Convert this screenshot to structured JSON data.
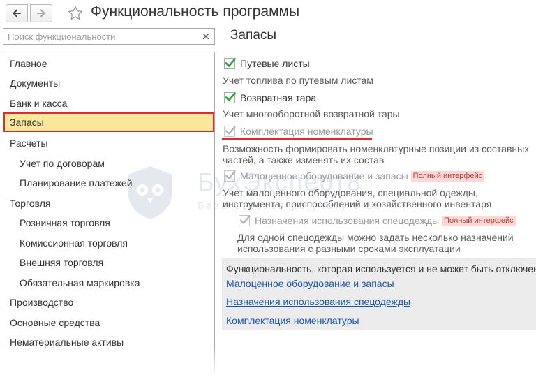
{
  "header": {
    "title": "Функциональность программы",
    "back_icon": "arrow-left-icon",
    "forward_icon": "arrow-right-icon",
    "favorite_icon": "star-icon"
  },
  "search": {
    "placeholder": "Поиск функциональности",
    "value": "",
    "clear_icon": "close-icon"
  },
  "sidebar": {
    "items": [
      {
        "label": "Главное",
        "level": 0,
        "selected": false
      },
      {
        "label": "Документы",
        "level": 0,
        "selected": false
      },
      {
        "label": "Банк и касса",
        "level": 0,
        "selected": false
      },
      {
        "label": "Запасы",
        "level": 0,
        "selected": true
      },
      {
        "label": "Расчеты",
        "level": 0,
        "selected": false
      },
      {
        "label": "Учет по договорам",
        "level": 1,
        "selected": false
      },
      {
        "label": "Планирование платежей",
        "level": 1,
        "selected": false
      },
      {
        "label": "Торговля",
        "level": 0,
        "selected": false
      },
      {
        "label": "Розничная торговля",
        "level": 1,
        "selected": false
      },
      {
        "label": "Комиссионная торговля",
        "level": 1,
        "selected": false
      },
      {
        "label": "Внешняя торговля",
        "level": 1,
        "selected": false
      },
      {
        "label": "Обязательная маркировка",
        "level": 1,
        "selected": false
      },
      {
        "label": "Производство",
        "level": 0,
        "selected": false
      },
      {
        "label": "Основные средства",
        "level": 0,
        "selected": false
      },
      {
        "label": "Нематериальные активы",
        "level": 0,
        "selected": false
      }
    ]
  },
  "main": {
    "section_title": "Запасы",
    "options": [
      {
        "label": "Путевые листы",
        "checked": true,
        "enabled": true,
        "description": "Учет топлива по путевым листам"
      },
      {
        "label": "Возвратная тара",
        "checked": true,
        "enabled": true,
        "description": "Учет многооборотной возвратной тары"
      },
      {
        "label": "Комплектация номенклатуры",
        "checked": true,
        "enabled": false,
        "description_line1": "Возможность формировать номенклатурные позиции из составных",
        "description_line2": "частей, а также изменять их состав"
      },
      {
        "label": "Малоценное оборудование и запасы",
        "checked": true,
        "enabled": false,
        "badge": "Полный интерфейс",
        "description_line1": "Учет малоценного оборудования, специальной одежды,",
        "description_line2": "инструмента, приспособлений и хозяйственного инвентаря"
      },
      {
        "label": "Назначения использования спецодежды",
        "checked": true,
        "enabled": false,
        "badge": "Полный интерфейс",
        "description_line1": "Для одной спецодежды можно задать несколько назначений",
        "description_line2": "использования с разными сроками эксплуатации"
      }
    ],
    "info_box": {
      "heading": "Функциональность, которая используется и не может быть отключена:",
      "links": [
        "Малоценное оборудование и запасы",
        "Назначения использования спецодежды",
        "Комплектация номенклатуры"
      ]
    }
  },
  "watermark": {
    "brand": "БухЭксперт8",
    "tagline": "База ответов по учету в 1С",
    "logo_icon": "owl-shield-icon"
  },
  "colors": {
    "selected_bg": "#f9e89a",
    "highlight_red": "#e32a2a",
    "check_green": "#2aa83a",
    "link_blue": "#1a56b0",
    "badge_bg": "#fbd9d9",
    "info_bg": "#ececec"
  }
}
